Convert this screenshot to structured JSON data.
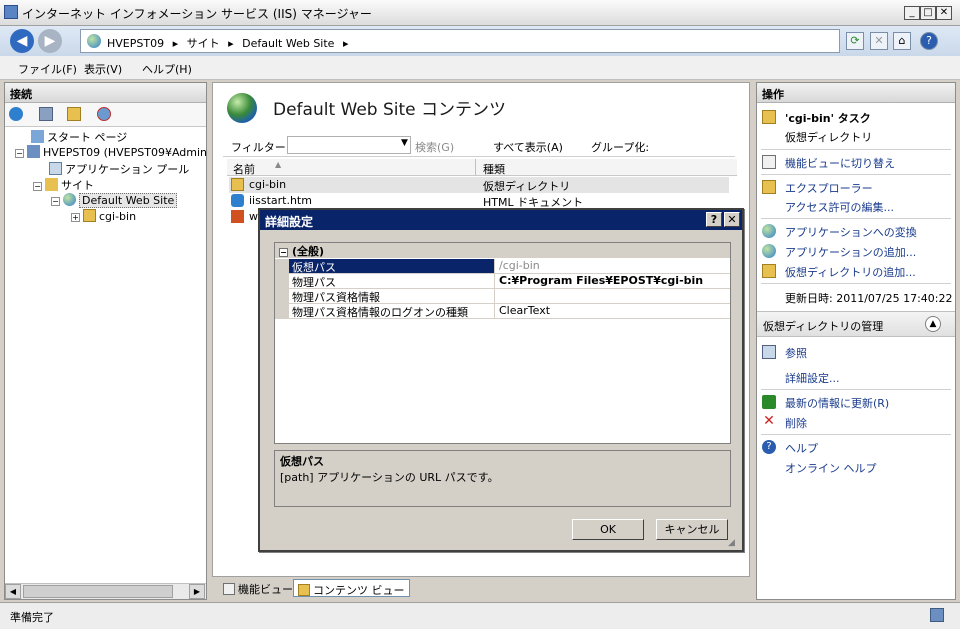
{
  "window": {
    "title": "インターネット インフォメーション サービス (IIS) マネージャー",
    "controls": {
      "minimize": "_",
      "maximize": "□",
      "close": "✕"
    }
  },
  "address": {
    "crumbs": [
      "HVEPST09",
      "サイト",
      "Default Web Site"
    ],
    "separator": "▸"
  },
  "menubar": {
    "file": "ファイル(F)",
    "view": "表示(V)",
    "help": "ヘルプ(H)"
  },
  "left_pane": {
    "header": "接続",
    "tree": [
      {
        "label": "スタート ページ"
      },
      {
        "label": "HVEPST09 (HVEPST09¥Admin"
      },
      {
        "label": "アプリケーション プール"
      },
      {
        "label": "サイト"
      },
      {
        "label": "Default Web Site"
      },
      {
        "label": "cgi-bin"
      }
    ]
  },
  "center": {
    "title": "Default Web Site コンテンツ",
    "filter_label": "フィルター:",
    "search_label": "検索(G)",
    "show_all_label": "すべて表示(A)",
    "group_label": "グループ化:",
    "col_name": "名前",
    "col_type": "種類",
    "rows": [
      {
        "name": "cgi-bin",
        "type": "仮想ディレクトリ"
      },
      {
        "name": "iisstart.htm",
        "type": "HTML ドキュメント"
      },
      {
        "name": "w",
        "type": ""
      }
    ],
    "tab_features": "機能ビュー",
    "tab_content": "コンテンツ ビュー"
  },
  "right_pane": {
    "header": "操作",
    "task_title": "'cgi-bin' タスク",
    "task_sub": "仮想ディレクトリ",
    "actions": [
      "機能ビューに切り替え",
      "エクスプローラー",
      "アクセス許可の編集...",
      "アプリケーションへの変換",
      "アプリケーションの追加...",
      "仮想ディレクトリの追加..."
    ],
    "updated": "更新日時: 2011/07/25 17:40:22",
    "manage_header": "仮想ディレクトリの管理",
    "manage_actions": [
      "参照",
      "詳細設定...",
      "最新の情報に更新(R)",
      "削除"
    ],
    "help": "ヘルプ",
    "online_help": "オンライン ヘルプ"
  },
  "status": {
    "text": "準備完了"
  },
  "dialog": {
    "title": "詳細設定",
    "help_btn": "?",
    "close_btn": "✕",
    "category": "(全般)",
    "properties": [
      {
        "key": "仮想パス",
        "value": "/cgi-bin"
      },
      {
        "key": "物理パス",
        "value": "C:¥Program Files¥EPOST¥cgi-bin"
      },
      {
        "key": "物理パス資格情報",
        "value": ""
      },
      {
        "key": "物理パス資格情報のログオンの種類",
        "value": "ClearText"
      }
    ],
    "desc_title": "仮想パス",
    "desc_text": "[path] アプリケーションの URL パスです。",
    "ok": "OK",
    "cancel": "キャンセル"
  },
  "colors": {
    "dialog_title": "#0a246a",
    "selection": "#0a246a",
    "link": "#1a3b8c"
  }
}
